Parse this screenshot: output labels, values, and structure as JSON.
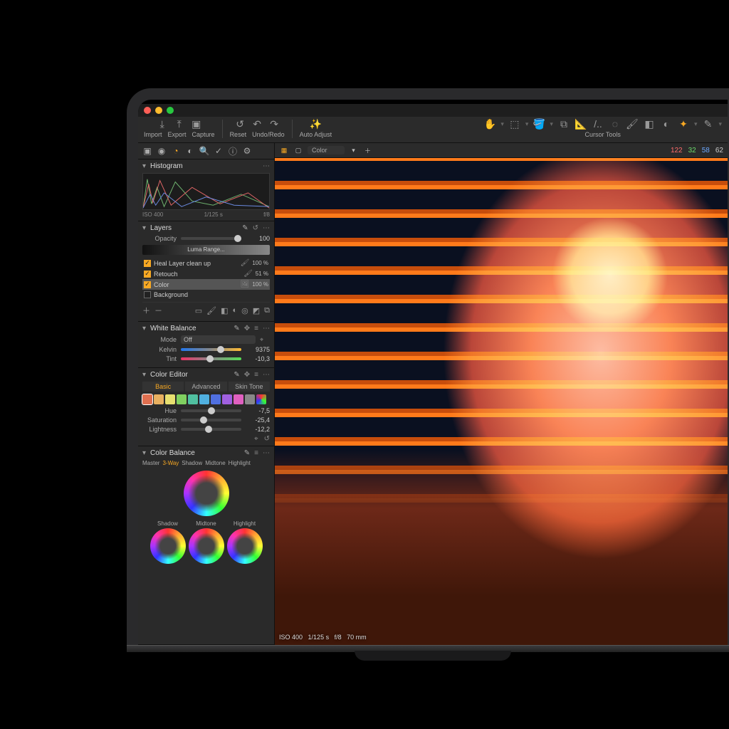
{
  "toolbar": {
    "import": "Import",
    "export": "Export",
    "capture": "Capture",
    "reset": "Reset",
    "undoredo": "Undo/Redo",
    "autoadjust": "Auto Adjust",
    "cursor_tools": "Cursor Tools"
  },
  "canvas_top": {
    "layer_select": "Color"
  },
  "rgb": {
    "r": "122",
    "g": "32",
    "b": "58",
    "l": "62"
  },
  "histogram": {
    "title": "Histogram",
    "iso": "ISO 400",
    "shutter": "1/125 s",
    "aperture": "f/8"
  },
  "layers": {
    "title": "Layers",
    "opacity": "Opacity",
    "opacity_val": "100",
    "luma": "Luma Range...",
    "items": [
      {
        "name": "Heal Layer clean up",
        "on": true,
        "pct": "100 %"
      },
      {
        "name": "Retouch",
        "on": true,
        "pct": "51 %"
      },
      {
        "name": "Color",
        "on": true,
        "pct": "100 %",
        "sel": true,
        "icon": "img"
      },
      {
        "name": "Background",
        "on": false,
        "pct": ""
      }
    ]
  },
  "wb": {
    "title": "White Balance",
    "mode": "Mode",
    "mode_val": "Off",
    "kelvin": "Kelvin",
    "kelvin_val": "9375",
    "tint": "Tint",
    "tint_val": "-10,3"
  },
  "ce": {
    "title": "Color Editor",
    "tabs": {
      "basic": "Basic",
      "advanced": "Advanced",
      "skintone": "Skin Tone"
    },
    "hue": "Hue",
    "hue_val": "-7,5",
    "sat": "Saturation",
    "sat_val": "-25,4",
    "light": "Lightness",
    "light_val": "-12,2",
    "swatches": [
      "#e07050",
      "#e8b060",
      "#e8e070",
      "#80d060",
      "#50c0a0",
      "#50b0e0",
      "#5070e0",
      "#a060e0",
      "#e060c0",
      "#888888"
    ]
  },
  "cb": {
    "title": "Color Balance",
    "tabs": {
      "master": "Master",
      "threeway": "3-Way",
      "shadow": "Shadow",
      "midtone": "Midtone",
      "highlight": "Highlight"
    },
    "wheels": {
      "shadow": "Shadow",
      "midtone": "Midtone",
      "highlight": "Highlight"
    }
  },
  "status": {
    "iso": "ISO 400",
    "shutter": "1/125 s",
    "aperture": "f/8",
    "focal": "70 mm"
  }
}
